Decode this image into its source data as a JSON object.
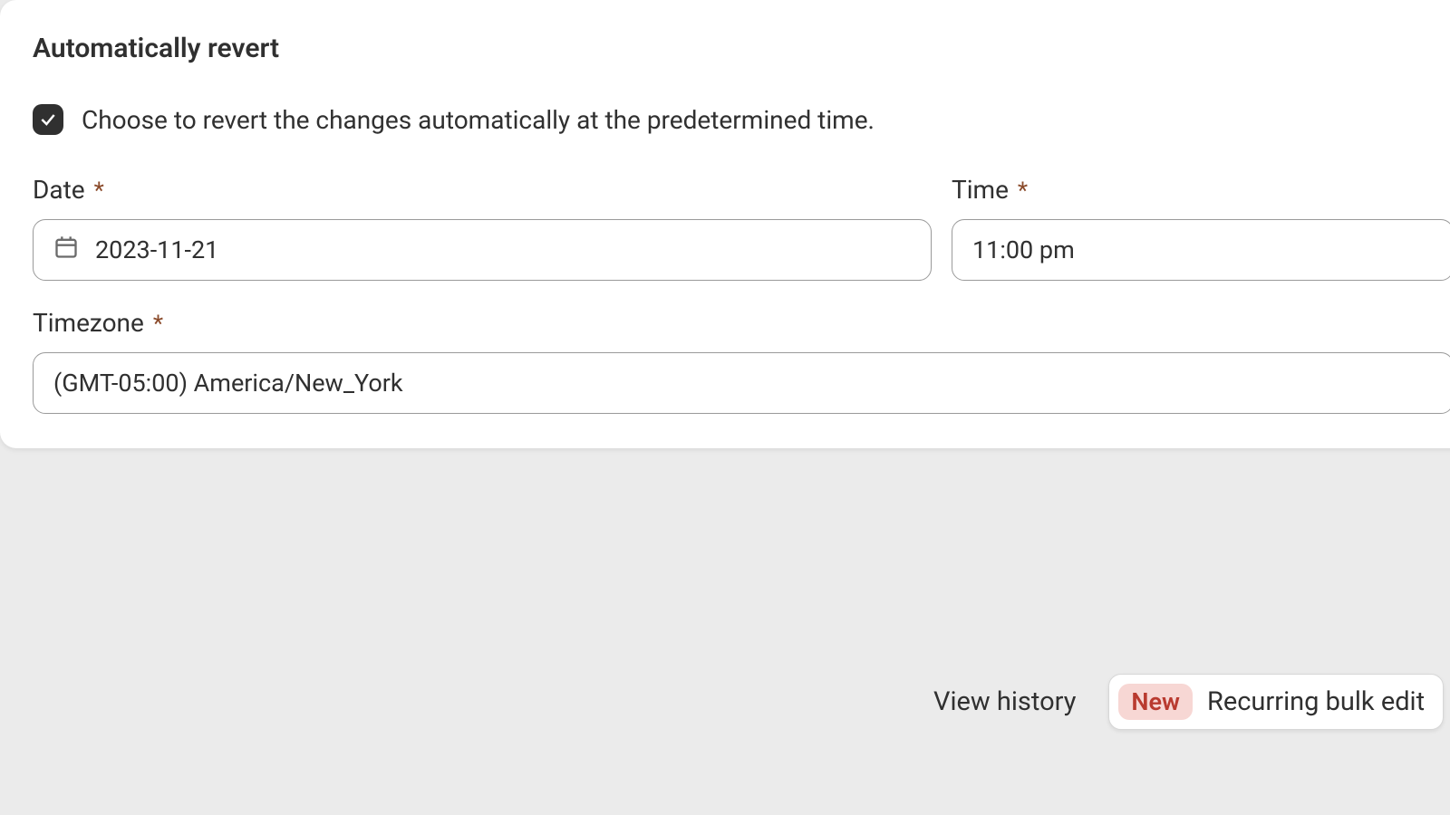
{
  "section": {
    "title": "Automatically revert",
    "checkbox_label": "Choose to revert the changes automatically at the predetermined time.",
    "checked": true
  },
  "fields": {
    "date": {
      "label": "Date",
      "required": "*",
      "value": "2023-11-21"
    },
    "time": {
      "label": "Time",
      "required": "*",
      "value": "11:00 pm"
    },
    "timezone": {
      "label": "Timezone",
      "required": "*",
      "value": "(GMT-05:00) America/New_York"
    }
  },
  "footer": {
    "view_history": "View history",
    "badge": "New",
    "recurring_label": "Recurring bulk edit"
  }
}
